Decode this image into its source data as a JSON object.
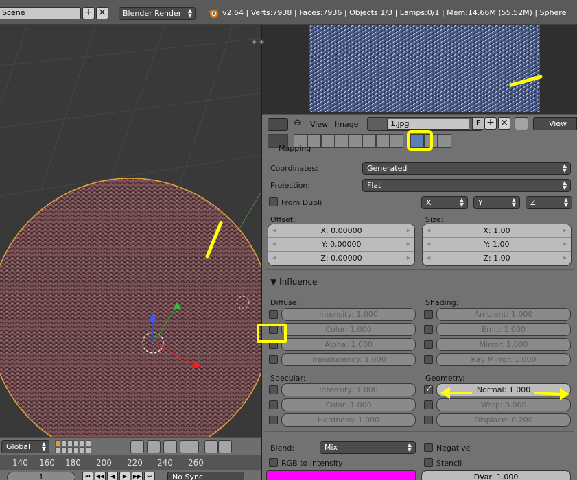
{
  "header": {
    "scene": "Scene",
    "render_engine": "Blender Render",
    "stats": "v2.64 | Verts:7938 | Faces:7936 | Objects:1/3 | Lamps:0/1 | Mem:14.66M (55.52M) | Sphere"
  },
  "viewport_footer": {
    "orientation": "Global"
  },
  "timeline": {
    "ticks": [
      "140",
      "160",
      "180",
      "200",
      "220",
      "240",
      "260"
    ],
    "frame": "1",
    "sync": "No Sync"
  },
  "image_editor": {
    "menu": [
      "View",
      "Image"
    ],
    "image_name": "1.jpg",
    "fake_user": "F",
    "view_label": "View"
  },
  "texture_mapping": {
    "panel_title": "Mapping",
    "coordinates_label": "Coordinates:",
    "coordinates_value": "Generated",
    "projection_label": "Projection:",
    "projection_value": "Flat",
    "from_dupli_label": "From Dupli",
    "axis_x": "X",
    "axis_y": "Y",
    "axis_z": "Z",
    "offset_label": "Offset:",
    "offset": [
      "X: 0.00000",
      "Y: 0.00000",
      "Z: 0.00000"
    ],
    "size_label": "Size:",
    "size": [
      "X: 1.00",
      "Y: 1.00",
      "Z: 1.00"
    ]
  },
  "influence": {
    "title": "Influence",
    "diffuse_label": "Diffuse:",
    "diffuse": [
      "Intensity: 1.000",
      "Color: 1.000",
      "Alpha: 1.000",
      "Translucency: 1.000"
    ],
    "shading_label": "Shading:",
    "shading": [
      "Ambient: 1.000",
      "Emit: 1.000",
      "Mirror: 1.000",
      "Ray Mirror: 1.000"
    ],
    "specular_label": "Specular:",
    "specular": [
      "Intensity: 1.000",
      "Color: 1.000",
      "Hardness: 1.000"
    ],
    "geometry_label": "Geometry:",
    "geometry": [
      "Normal: 1.000",
      "Warp: 0.000",
      "Displace: 0.200"
    ],
    "blend_label": "Blend:",
    "blend_value": "Mix",
    "negative_label": "Negative",
    "rgb_to_intensity_label": "RGB to Intensity",
    "stencil_label": "Stencil",
    "dvar": "DVar: 1.000",
    "swatch_color": "#ff00ff"
  },
  "colors": {
    "annotation": "#ffff00",
    "sphere": "#7a5257",
    "selection_outline": "#e8a33a",
    "active_tab": "#5a7fb4"
  }
}
